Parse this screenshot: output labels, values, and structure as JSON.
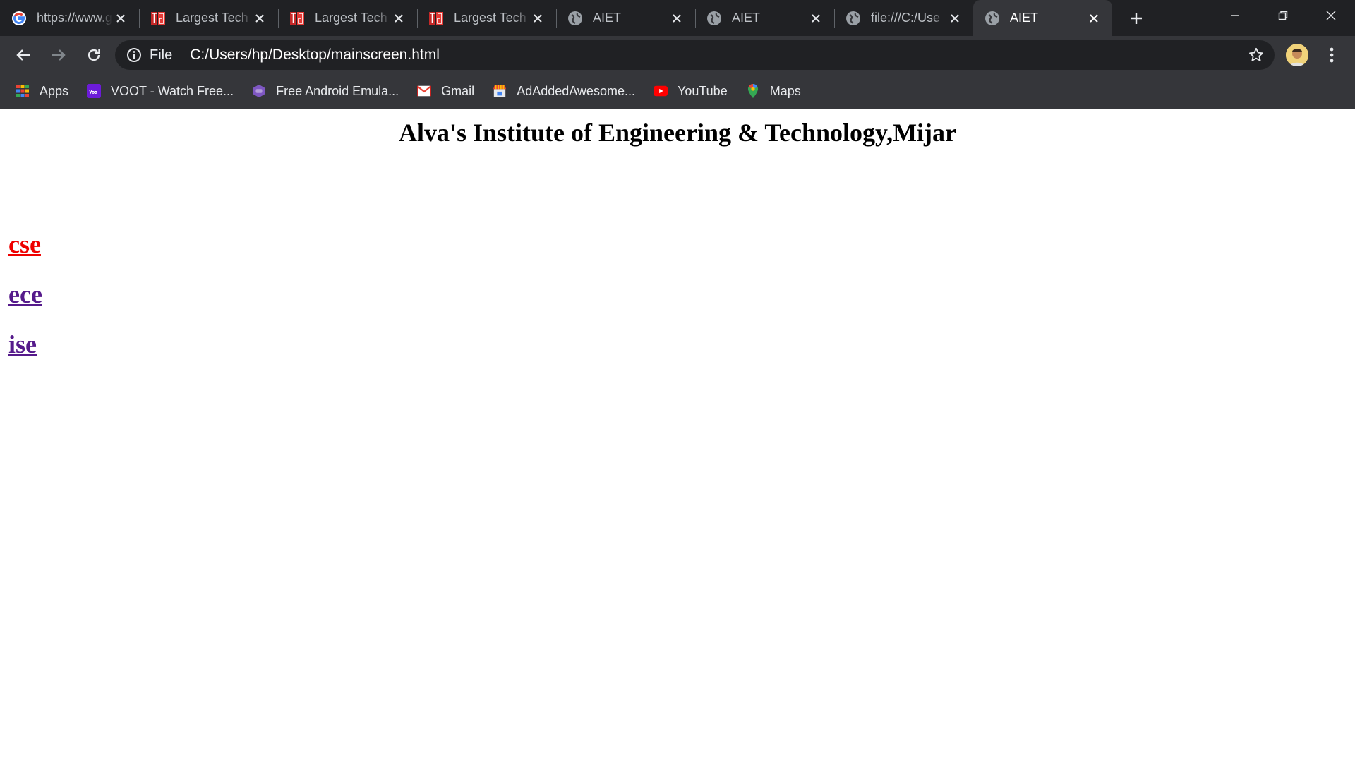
{
  "tabs": [
    {
      "title": "https://www.google.com",
      "favicon": "google-icon"
    },
    {
      "title": "Largest Tech",
      "favicon": "tg-icon"
    },
    {
      "title": "Largest Tech",
      "favicon": "tg-icon"
    },
    {
      "title": "Largest Tech",
      "favicon": "tg-icon"
    },
    {
      "title": "AIET",
      "favicon": "globe-icon"
    },
    {
      "title": "AIET",
      "favicon": "globe-icon"
    },
    {
      "title": "file:///C:/Use",
      "favicon": "globe-icon"
    },
    {
      "title": "AIET",
      "favicon": "globe-icon",
      "active": true
    }
  ],
  "toolbar": {
    "chip": "File",
    "url": "C:/Users/hp/Desktop/mainscreen.html"
  },
  "bookmarks": [
    {
      "label": "Apps",
      "icon": "apps-grid-icon"
    },
    {
      "label": "VOOT - Watch Free...",
      "icon": "voot-icon"
    },
    {
      "label": "Free Android Emula...",
      "icon": "emulator-icon"
    },
    {
      "label": "Gmail",
      "icon": "gmail-icon"
    },
    {
      "label": "AdAddedAwesome...",
      "icon": "store-icon"
    },
    {
      "label": "YouTube",
      "icon": "youtube-icon"
    },
    {
      "label": "Maps",
      "icon": "maps-icon"
    }
  ],
  "page": {
    "heading": "Alva's Institute of Engineering & Technology,Mijar",
    "links": [
      {
        "label": "cse",
        "state": "active"
      },
      {
        "label": "ece",
        "state": "visited"
      },
      {
        "label": "ise",
        "state": "visited"
      }
    ]
  },
  "colors": {
    "tabstrip": "#202124",
    "toolbar": "#35363a",
    "link_active": "#ee0000",
    "link_visited": "#551a8b"
  }
}
